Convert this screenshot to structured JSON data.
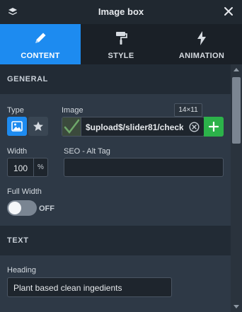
{
  "window": {
    "title": "Image box"
  },
  "tabs": [
    {
      "label": "CONTENT",
      "icon": "pencil-icon",
      "active": true
    },
    {
      "label": "STYLE",
      "icon": "paint-roller-icon",
      "active": false
    },
    {
      "label": "ANIMATION",
      "icon": "lightning-icon",
      "active": false
    }
  ],
  "general": {
    "header": "GENERAL",
    "type_label": "Type",
    "image_label": "Image",
    "image_path": "$upload$/slider81/check",
    "image_dimensions": "14×11",
    "width_label": "Width",
    "width_value": "100",
    "width_unit": "%",
    "seo_label": "SEO - Alt Tag",
    "seo_value": "",
    "full_width_label": "Full Width",
    "full_width_state": "OFF"
  },
  "text_section": {
    "header": "TEXT",
    "heading_label": "Heading",
    "heading_value": "Plant based clean ingedients"
  },
  "colors": {
    "accent": "#1d8bf0",
    "add_button": "#2cb24a",
    "panel_bg": "#2e3946",
    "header_bg": "#222b35"
  }
}
